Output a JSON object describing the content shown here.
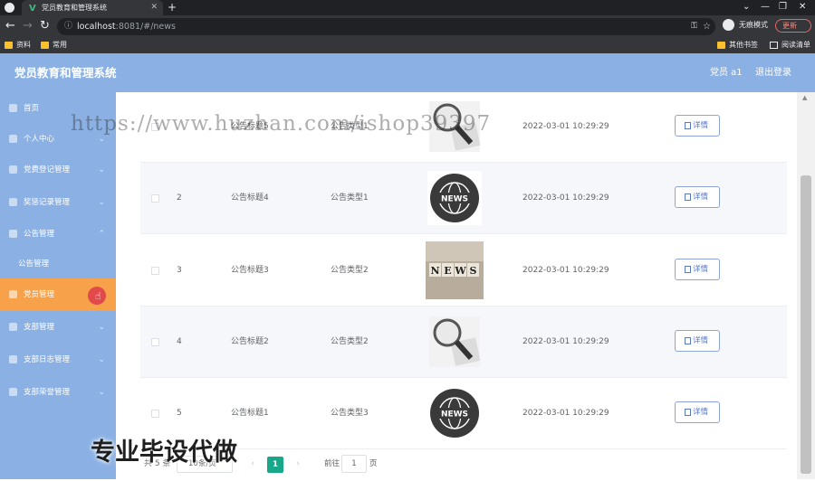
{
  "browser": {
    "tab_title": "党员教育和管理系统",
    "address_host": "localhost",
    "address_path": ":8081/#/news",
    "incognito_label": "无痕模式",
    "update_label": "更新",
    "bookmarks": [
      "资料",
      "常用"
    ],
    "bookmarks_right": [
      "其他书签",
      "阅读清单"
    ]
  },
  "header": {
    "title": "党员教育和管理系统",
    "user": "党员 a1",
    "logout": "退出登录"
  },
  "sidebar": {
    "items": [
      {
        "label": "首页",
        "icon": "home-icon"
      },
      {
        "label": "个人中心",
        "icon": "user-icon"
      },
      {
        "label": "党费登记管理",
        "icon": "wallet-icon"
      },
      {
        "label": "奖惩记录管理",
        "icon": "award-icon"
      },
      {
        "label": "公告管理",
        "icon": "notice-icon"
      },
      {
        "label": "公告管理",
        "icon": ""
      },
      {
        "label": "党员管理",
        "icon": "member-icon"
      },
      {
        "label": "支部管理",
        "icon": "branch-icon"
      },
      {
        "label": "支部日志管理",
        "icon": "log-icon"
      },
      {
        "label": "支部荣誉管理",
        "icon": "honor-icon"
      }
    ]
  },
  "table": {
    "rows": [
      {
        "index": "",
        "title": "公告标题5",
        "type": "公告类型1",
        "time": "2022-03-01 10:29:29",
        "image": "magnifier-news"
      },
      {
        "index": "2",
        "title": "公告标题4",
        "type": "公告类型1",
        "time": "2022-03-01 10:29:29",
        "image": "globe-news"
      },
      {
        "index": "3",
        "title": "公告标题3",
        "type": "公告类型2",
        "time": "2022-03-01 10:29:29",
        "image": "blocks-news"
      },
      {
        "index": "4",
        "title": "公告标题2",
        "type": "公告类型2",
        "time": "2022-03-01 10:29:29",
        "image": "magnifier-news"
      },
      {
        "index": "5",
        "title": "公告标题1",
        "type": "公告类型3",
        "time": "2022-03-01 10:29:29",
        "image": "globe-news"
      }
    ],
    "detail_label": "详情"
  },
  "pagination": {
    "total": "共 5 条",
    "page_size": "10条/页",
    "current": "1",
    "goto_label": "前往",
    "goto_value": "1",
    "unit": "页"
  },
  "overlays": {
    "url_watermark": "https://www.huzhan.com/ishop39397",
    "bottom_watermark": "专业毕设代做"
  },
  "colors": {
    "sidebar": "#8bb1e4",
    "active_menu": "#f7a24b",
    "page_current": "#17a88a",
    "button_border": "#8ea3d6"
  }
}
